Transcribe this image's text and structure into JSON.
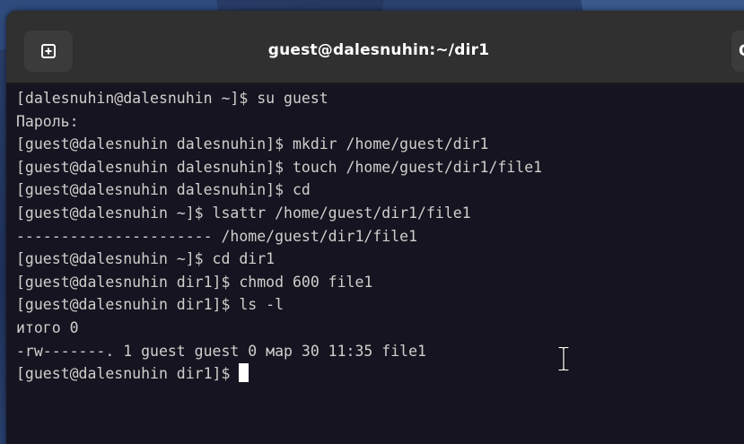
{
  "window": {
    "title": "guest@dalesnuhin:~/dir1",
    "search_label": "Q"
  },
  "icons": {
    "new_tab": "new-tab-icon",
    "search": "search-icon",
    "text_cursor": "i-beam-cursor-icon"
  },
  "colors": {
    "terminal_bg": "#171421",
    "titlebar_bg": "#303030",
    "text": "#d0cfcc"
  },
  "terminal": {
    "lines": [
      "[dalesnuhin@dalesnuhin ~]$ su guest",
      "Пароль:",
      "[guest@dalesnuhin dalesnuhin]$ mkdir /home/guest/dir1",
      "[guest@dalesnuhin dalesnuhin]$ touch /home/guest/dir1/file1",
      "[guest@dalesnuhin dalesnuhin]$ cd",
      "[guest@dalesnuhin ~]$ lsattr /home/guest/dir1/file1",
      "---------------------- /home/guest/dir1/file1",
      "[guest@dalesnuhin ~]$ cd dir1",
      "[guest@dalesnuhin dir1]$ chmod 600 file1",
      "[guest@dalesnuhin dir1]$ ls -l",
      "итого 0",
      "-rw-------. 1 guest guest 0 мар 30 11:35 file1"
    ],
    "prompt": "[guest@dalesnuhin dir1]$ "
  }
}
